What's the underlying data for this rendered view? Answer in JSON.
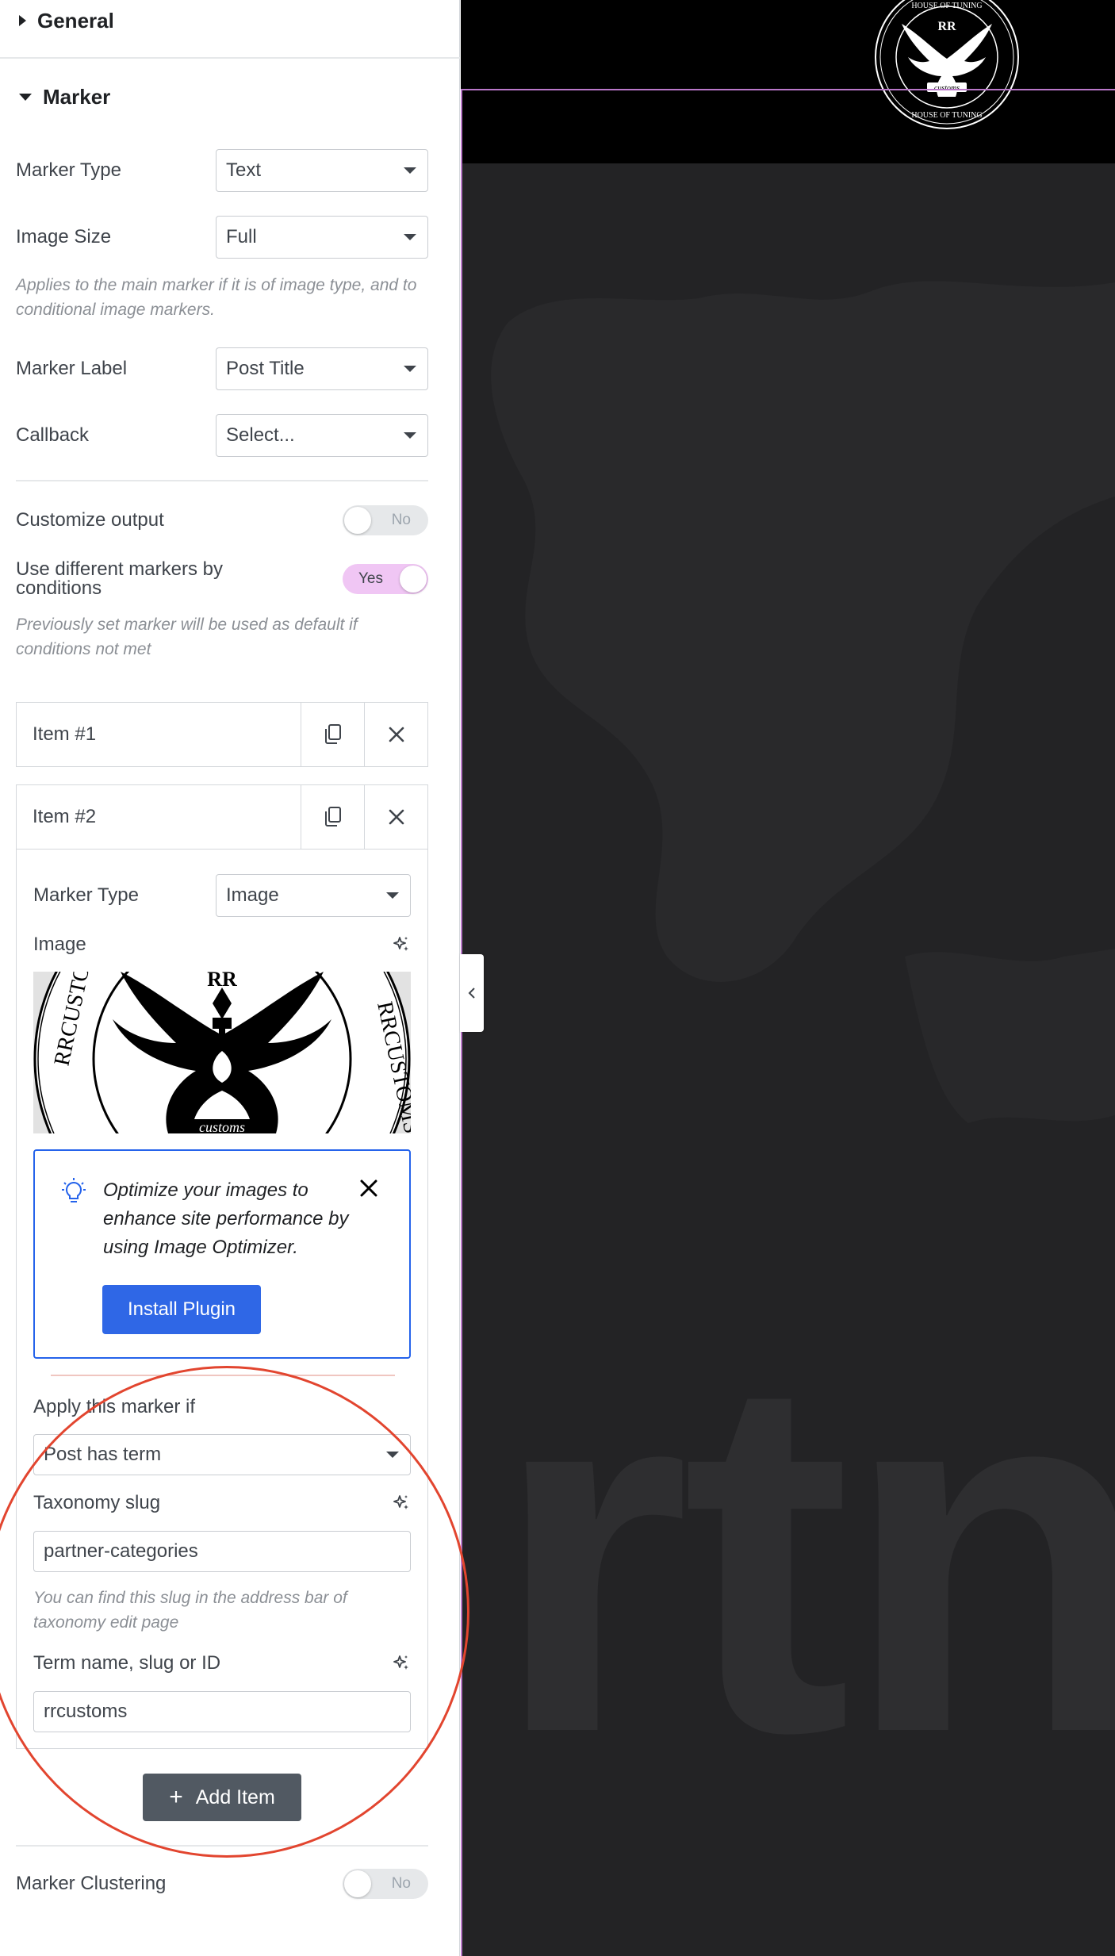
{
  "panel": {
    "general": {
      "title": "General"
    },
    "marker": {
      "title": "Marker",
      "marker_type": {
        "label": "Marker Type",
        "value": "Text"
      },
      "image_size": {
        "label": "Image Size",
        "value": "Full"
      },
      "image_size_help": "Applies to the main marker if it is of image type, and to conditional image markers.",
      "marker_label": {
        "label": "Marker Label",
        "value": "Post Title"
      },
      "callback": {
        "label": "Callback",
        "value": "Select..."
      },
      "customize_output": {
        "label": "Customize output",
        "state": "No"
      },
      "different_markers": {
        "label": "Use different markers by conditions",
        "state": "Yes"
      },
      "different_markers_help": "Previously set marker will be used as default if conditions not met",
      "items": [
        {
          "title": "Item #1"
        },
        {
          "title": "Item #2",
          "marker_type": {
            "label": "Marker Type",
            "value": "Image"
          },
          "image_label": "Image",
          "notice": {
            "message": "Optimize your images to enhance site performance by using Image Optimizer.",
            "button": "Install Plugin"
          },
          "apply_if": {
            "label": "Apply this marker if",
            "value": "Post has term"
          },
          "taxonomy": {
            "label": "Taxonomy slug",
            "value": "partner-categories",
            "help": "You can find this slug in the address bar of taxonomy edit page"
          },
          "term": {
            "label": "Term name, slug or ID",
            "value": "rrcustoms"
          }
        }
      ],
      "add_item": "Add Item",
      "clustering": {
        "label": "Marker Clustering",
        "state": "No"
      }
    }
  },
  "preview": {
    "logo_text": {
      "top": "HOUSE OF TUNING",
      "left": "RRCUSTOMS",
      "right": "RRCUSTOMS",
      "bottom": "HOUSE OF TUNING",
      "center": "RR",
      "ribbon": "customs"
    },
    "big_text": "rtn"
  },
  "colors": {
    "accent_toggle": "#f0c6f4",
    "notice_border": "#2563eb",
    "install_button": "#2f67e6",
    "annotation": "#e2452f",
    "add_button": "#515962"
  },
  "icons": [
    "caret-right-icon",
    "caret-down-icon",
    "duplicate-icon",
    "close-icon",
    "ai-sparkle-icon",
    "lightbulb-icon",
    "plus-icon",
    "chevron-left-icon"
  ]
}
